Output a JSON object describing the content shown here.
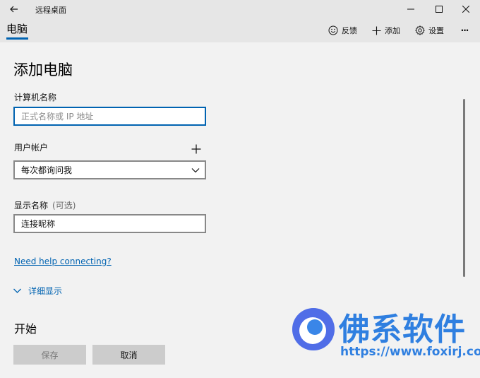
{
  "window": {
    "title": "远程桌面"
  },
  "topbar": {
    "tab_label": "电脑",
    "feedback_label": "反馈",
    "add_label": "添加",
    "settings_label": "设置",
    "more_label": "···"
  },
  "form": {
    "page_title": "添加电脑",
    "computer_name_label": "计算机名称",
    "computer_name_placeholder": "正式名称或 IP 地址",
    "computer_name_value": "",
    "user_account_label": "用户帐户",
    "user_account_selected": "每次都询问我",
    "display_name_label": "显示名称",
    "display_name_optional": "(可选)",
    "display_name_value": "连接昵称",
    "help_link": "Need help connecting?",
    "details_label": "详细显示",
    "start_label": "开始",
    "save_label": "保存",
    "cancel_label": "取消"
  },
  "watermark": {
    "brand": "佛系软件",
    "url": "https://www.foxirj.com"
  },
  "colors": {
    "accent": "#0063b1",
    "watermark": "#2f7fe0"
  },
  "icons": {
    "back": "arrow-left-icon",
    "minimize": "minimize-icon",
    "maximize": "maximize-icon",
    "close": "close-icon",
    "feedback": "smiley-icon",
    "add": "plus-icon",
    "settings": "gear-icon",
    "add_user": "plus-icon",
    "dropdown": "chevron-down-icon",
    "details": "chevron-down-icon"
  }
}
